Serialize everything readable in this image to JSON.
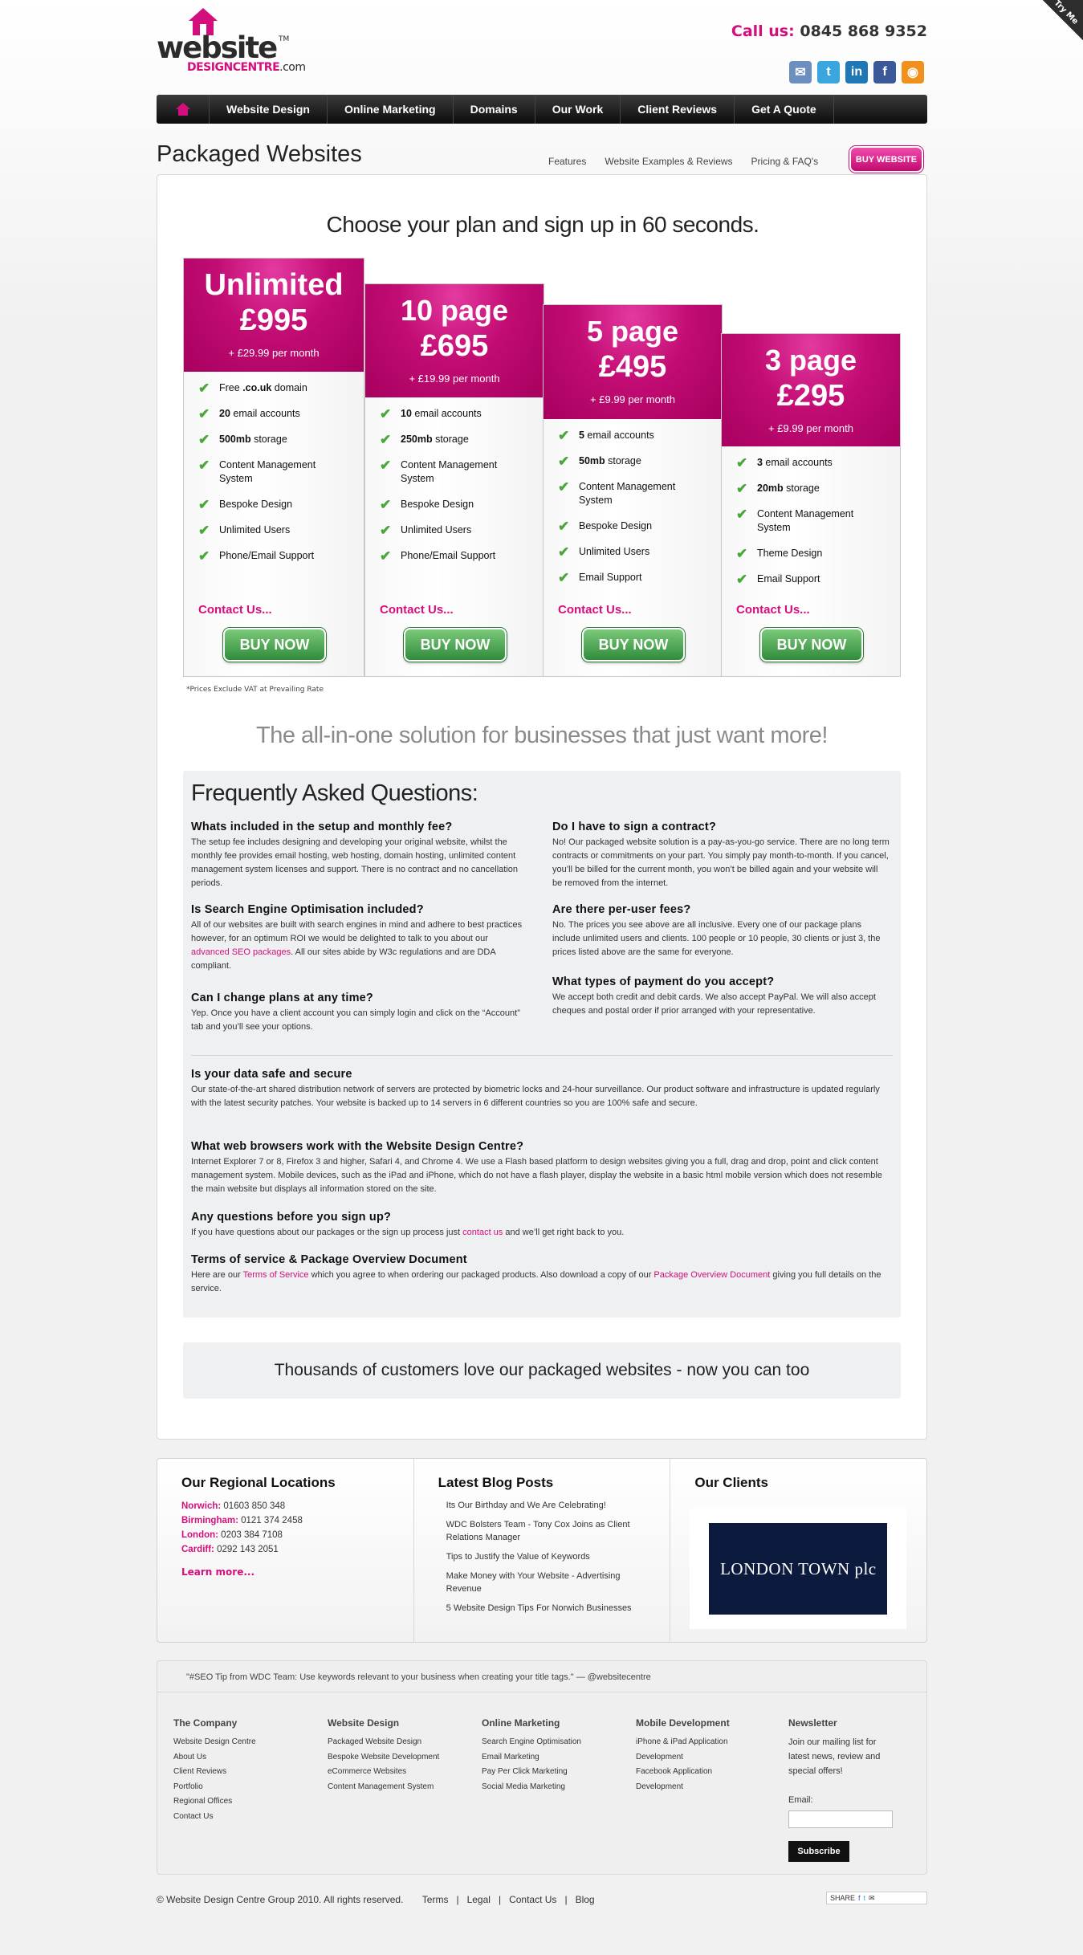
{
  "header": {
    "logo": {
      "word": "website",
      "tm": "TM",
      "line2_a": "DESIGN",
      "line2_b": "CENTRE",
      "line2_c": ".com"
    },
    "call_label": "Call us:",
    "phone": "0845 868 9352",
    "tryme": "Try Me",
    "social": [
      {
        "icon": "email-icon",
        "glyph": "✉",
        "color": "#6b8fbf"
      },
      {
        "icon": "twitter-icon",
        "glyph": "t",
        "color": "#3aa6dd"
      },
      {
        "icon": "linkedin-icon",
        "glyph": "in",
        "color": "#1f78b5"
      },
      {
        "icon": "facebook-icon",
        "glyph": "f",
        "color": "#3b5998"
      },
      {
        "icon": "rss-icon",
        "glyph": "◉",
        "color": "#f0911b"
      }
    ]
  },
  "nav": {
    "items": [
      "Website Design",
      "Online Marketing",
      "Domains",
      "Our Work",
      "Client Reviews",
      "Get A Quote"
    ]
  },
  "title_row": {
    "title": "Packaged Websites",
    "subnav": [
      "Features",
      "Website Examples & Reviews",
      "Pricing & FAQ's"
    ],
    "buy_button": "BUY WEBSITE"
  },
  "pricing": {
    "headline": "Choose your plan and sign up in 60 seconds.",
    "contact_label": "Contact Us...",
    "buy_label": "BUY NOW",
    "vat_note": "*Prices Exclude VAT at Prevailing Rate",
    "plans": [
      {
        "name": "Unlimited",
        "price": "£995",
        "monthly": "+ £29.99 per month",
        "features": [
          {
            "bold": "",
            "pre": "Free ",
            "b": ".co.uk",
            "post": " domain"
          },
          {
            "pre": "",
            "b": "20",
            "post": " email accounts"
          },
          {
            "pre": "",
            "b": "500mb",
            "post": " storage"
          },
          {
            "pre": "Content Management System",
            "b": "",
            "post": ""
          },
          {
            "pre": "Bespoke Design",
            "b": "",
            "post": ""
          },
          {
            "pre": "Unlimited Users",
            "b": "",
            "post": ""
          },
          {
            "pre": "Phone/Email Support",
            "b": "",
            "post": ""
          }
        ]
      },
      {
        "name": "10 page",
        "price": "£695",
        "monthly": "+ £19.99 per month",
        "features": [
          {
            "pre": "",
            "b": "10",
            "post": " email accounts"
          },
          {
            "pre": "",
            "b": "250mb",
            "post": " storage"
          },
          {
            "pre": "Content Management System",
            "b": "",
            "post": ""
          },
          {
            "pre": "Bespoke Design",
            "b": "",
            "post": ""
          },
          {
            "pre": "Unlimited Users",
            "b": "",
            "post": ""
          },
          {
            "pre": "Phone/Email Support",
            "b": "",
            "post": ""
          }
        ]
      },
      {
        "name": "5 page",
        "price": "£495",
        "monthly": "+ £9.99 per month",
        "features": [
          {
            "pre": "",
            "b": "5",
            "post": " email accounts"
          },
          {
            "pre": "",
            "b": "50mb",
            "post": " storage"
          },
          {
            "pre": "Content Management System",
            "b": "",
            "post": ""
          },
          {
            "pre": "Bespoke Design",
            "b": "",
            "post": ""
          },
          {
            "pre": "Unlimited Users",
            "b": "",
            "post": ""
          },
          {
            "pre": "Email Support",
            "b": "",
            "post": ""
          }
        ]
      },
      {
        "name": "3 page",
        "price": "£295",
        "monthly": "+ £9.99 per month",
        "features": [
          {
            "pre": "",
            "b": "3",
            "post": " email accounts"
          },
          {
            "pre": "",
            "b": "20mb",
            "post": " storage"
          },
          {
            "pre": "Content Management System",
            "b": "",
            "post": ""
          },
          {
            "pre": "Theme Design",
            "b": "",
            "post": ""
          },
          {
            "pre": "Email Support",
            "b": "",
            "post": ""
          }
        ]
      }
    ]
  },
  "allinone": "The all-in-one solution for businesses that just want more!",
  "faq": {
    "title": "Frequently Asked Questions:",
    "q1": {
      "q": "Whats included in the setup and monthly fee?",
      "a": "The setup fee includes designing and developing your original website, whilst the monthly fee provides email hosting, web hosting, domain hosting, unlimited content management system licenses and support. There is no contract and no cancellation periods."
    },
    "q2": {
      "q": "Is Search Engine Optimisation included?",
      "a1": "All of our websites are built with search engines in mind and adhere to best practices however, for an optimum ROI we would be delighted to talk to you about our ",
      "link": "advanced SEO packages",
      "a2": ".  All our sites abide by W3c regulations and are DDA compliant."
    },
    "q3": {
      "q": "Can I change plans at any time?",
      "a": "Yep. Once you have a client account you can simply login and click on the “Account” tab and you’ll see your options."
    },
    "q4": {
      "q": "Do I have to sign a contract?",
      "a": "No! Our packaged website solution is a pay-as-you-go service. There are no long term contracts or commitments on your part. You simply pay month-to-month. If you cancel, you’ll be billed for the current month, you won’t be billed again and your website will be removed from the internet."
    },
    "q5": {
      "q": "Are there per-user fees?",
      "a": "No. The prices you see above are all inclusive. Every one of our package plans include unlimited users and clients. 100 people or 10 people, 30 clients or just 3, the prices listed above are the same for everyone."
    },
    "q6": {
      "q": "What types of payment do you accept?",
      "a": "We accept both credit and debit cards. We also accept PayPal. We will also accept cheques and postal order if prior arranged with your representative."
    },
    "q7": {
      "q": "Is your data safe and secure",
      "a": "Our state-of-the-art shared distribution network of servers are protected by biometric locks and 24-hour surveillance. Our product software and infrastructure is updated regularly with the latest security patches. Your website is backed up to 14 servers in 6 different countries so you are 100% safe and secure."
    },
    "q8": {
      "q": "What web browsers work with the Website Design Centre?",
      "a": "Internet Explorer 7 or 8, Firefox 3 and higher, Safari 4, and Chrome 4. We use a Flash based platform to design websites giving you a full, drag and drop, point and click content management system. Mobile devices, such as the iPad and iPhone, which do not have a flash player, display the website in a basic html mobile version which does not resemble the main website but displays all information stored on the site."
    },
    "q9": {
      "q": "Any questions before you sign up?",
      "a1": "If you have questions about our packages or the sign up process just ",
      "link": "contact us",
      "a2": " and we’ll get right back to you."
    },
    "q10": {
      "q": "Terms of service & Package Overview Document",
      "a1": "Here are our ",
      "link1": "Terms of Service",
      "a2": " which you agree to when ordering our packaged products. Also download a copy of our ",
      "link2": "Package Overview Document",
      "a3": " giving you full details on the service."
    }
  },
  "thousands": "Thousands of customers love our packaged websites - now you can too",
  "locations": {
    "title": "Our Regional Locations",
    "items": [
      {
        "city": "Norwich:",
        "phone": " 01603 850 348"
      },
      {
        "city": "Birmingham:",
        "phone": " 0121 374 2458"
      },
      {
        "city": "London:",
        "phone": " 0203 384 7108"
      },
      {
        "city": "Cardiff:",
        "phone": " 0292 143 2051"
      }
    ],
    "learn_more": "Learn more..."
  },
  "blog": {
    "title": "Latest Blog Posts",
    "posts": [
      "Its Our Birthday and We Are Celebrating!",
      "WDC Bolsters Team - Tony Cox Joins as Client Relations Manager",
      "Tips to Justify the Value of Keywords",
      "Make Money with Your Website - Advertising Revenue",
      "5 Website Design Tips For Norwich Businesses"
    ]
  },
  "clients": {
    "title": "Our Clients",
    "logo_text": "LONDON TOWN plc"
  },
  "footer": {
    "tweet": "\"#SEO Tip from WDC Team: Use keywords relevant to your business when creating your title tags.\" — @websitecentre",
    "cols": [
      {
        "title": "The Company",
        "links": [
          "Website Design Centre",
          "About Us",
          "Client Reviews",
          "Portfolio",
          "Regional Offices",
          "Contact Us"
        ]
      },
      {
        "title": "Website Design",
        "links": [
          "Packaged Website Design",
          "Bespoke Website Development",
          "eCommerce Websites",
          "Content Management System"
        ]
      },
      {
        "title": "Online Marketing",
        "links": [
          "Search Engine Optimisation",
          "Email Marketing",
          "Pay Per Click Marketing",
          "Social Media Marketing"
        ]
      },
      {
        "title": "Mobile Development",
        "links": [
          "iPhone & iPad Application Development",
          "Facebook Application Development"
        ]
      }
    ],
    "newsletter": {
      "title": "Newsletter",
      "text": "Join our mailing list for latest news, review and special offers!",
      "email_label": "Email:",
      "subscribe": "Subscribe"
    }
  },
  "bottom": {
    "copyright": "© Website Design Centre Group 2010. All rights reserved.",
    "links": [
      "Terms",
      "Legal",
      "Contact Us",
      "Blog"
    ],
    "share": "SHARE"
  }
}
